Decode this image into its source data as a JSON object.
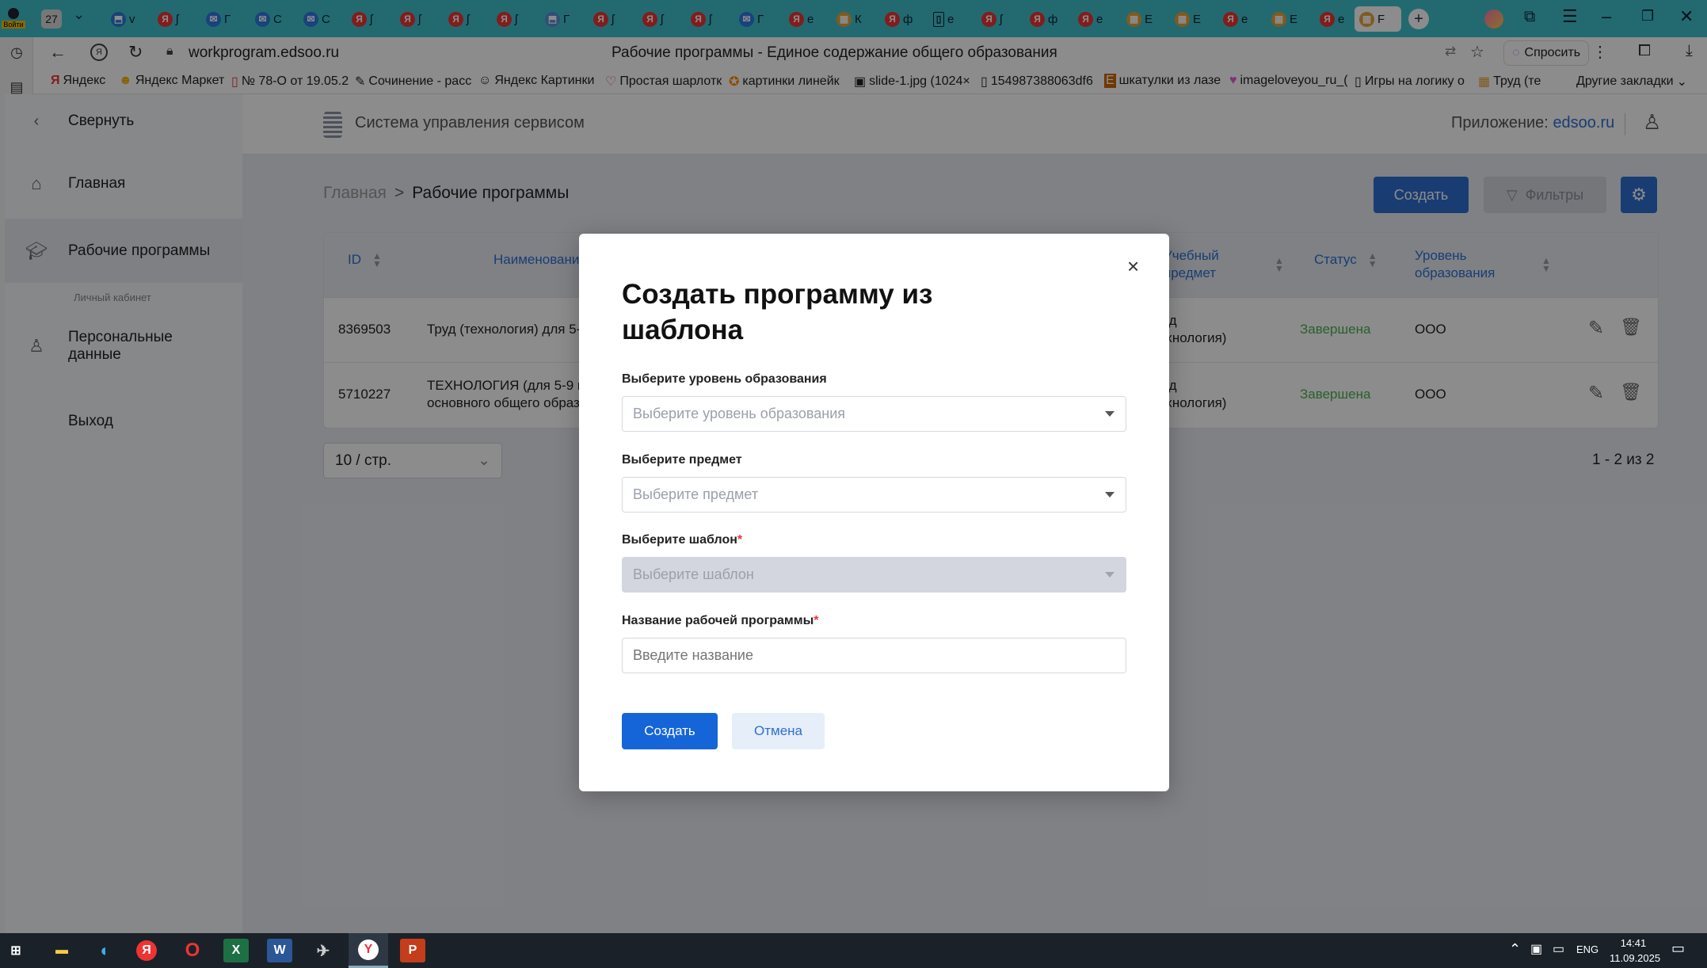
{
  "browser": {
    "tabs": [
      {
        "icon": "profile",
        "label": "Войти"
      },
      {
        "icon": "counter",
        "label": "27"
      },
      {
        "icon": "chevron",
        "label": "⌄"
      },
      {
        "icon": "site",
        "label": "v"
      },
      {
        "icon": "yandex",
        "label": "Я"
      },
      {
        "icon": "mail",
        "label": "Г"
      },
      {
        "icon": "mail",
        "label": "С"
      },
      {
        "icon": "mail",
        "label": "С"
      },
      {
        "icon": "yandex",
        "label": "Я"
      },
      {
        "icon": "yandex",
        "label": "Я"
      },
      {
        "icon": "yandex",
        "label": "Я"
      },
      {
        "icon": "yandex",
        "label": "Я"
      },
      {
        "icon": "site",
        "label": "Г"
      },
      {
        "icon": "yandex",
        "label": "Я"
      },
      {
        "icon": "yandex",
        "label": "Я"
      },
      {
        "icon": "yandex",
        "label": "Я"
      },
      {
        "icon": "mail",
        "label": "Г"
      },
      {
        "icon": "yandex",
        "label": "е"
      },
      {
        "icon": "site",
        "label": "К"
      },
      {
        "icon": "yandex",
        "label": "ф"
      },
      {
        "icon": "doc",
        "label": "е"
      },
      {
        "icon": "yandex",
        "label": "Я"
      },
      {
        "icon": "yandex",
        "label": "ф"
      },
      {
        "icon": "yandex",
        "label": "е"
      },
      {
        "icon": "site",
        "label": "Е"
      },
      {
        "icon": "site",
        "label": "Е"
      },
      {
        "icon": "yandex",
        "label": "е"
      },
      {
        "icon": "site",
        "label": "Е"
      },
      {
        "icon": "yandex",
        "label": "е"
      },
      {
        "icon": "site",
        "label": "F"
      }
    ],
    "new_tab": "+",
    "url": "workprogram.edsoo.ru",
    "page_title": "Рабочие программы - Единое содержание общего образования",
    "ask_button": "Спросить",
    "bookmarks": [
      "Яндекс",
      "Яндекс Маркет",
      "№ 78-О от 19.05.2",
      "Сочинение - расс",
      "Яндекс Картинки",
      "Простая шарлотк",
      "картинки линейк",
      "slide-1.jpg (1024×",
      "154987388063df6",
      "шкатулки из лазе",
      "imageloveyou_ru_(",
      "Игры на логику о",
      "Труд (те"
    ],
    "other_bookmarks": "Другие закладки"
  },
  "sidebar": {
    "collapse": "Свернуть",
    "home": "Главная",
    "programs": "Рабочие программы",
    "section_label": "Личный кабинет",
    "personal": "Персональные данные",
    "exit": "Выход"
  },
  "header": {
    "system_title": "Система управления сервисом",
    "app_label": "Приложение:",
    "app_value": "edsoo.ru"
  },
  "page": {
    "breadcrumb_root": "Главная",
    "breadcrumb_sep": ">",
    "breadcrumb_current": "Рабочие программы",
    "create_button": "Создать",
    "filters_button": "Фильтры"
  },
  "table": {
    "columns": [
      "ID",
      "Наименовани",
      "Учебный предмет",
      "Статус",
      "Уровень образования"
    ],
    "rows": [
      {
        "id": "8369503",
        "name": "Труд (технология) для 5-",
        "subject": "Труд (технология)",
        "status": "Завершена",
        "level": "ООО"
      },
      {
        "id": "5710227",
        "name": "ТЕХНОЛОГИЯ (для 5-9 к основного общего образ",
        "subject": "Труд (технология)",
        "status": "Завершена",
        "level": "ООО"
      }
    ],
    "page_size": "10 / стр.",
    "range": "1 - 2 из 2"
  },
  "modal": {
    "title": "Создать программу из шаблона",
    "close": "×",
    "level_label": "Выберите уровень образования",
    "level_placeholder": "Выберите уровень образования",
    "subject_label": "Выберите предмет",
    "subject_placeholder": "Выберите предмет",
    "template_label": "Выберите шаблон",
    "template_placeholder": "Выберите шаблон",
    "name_label": "Название рабочей программы",
    "name_placeholder": "Введите название",
    "required_mark": "*",
    "submit": "Создать",
    "cancel": "Отмена"
  },
  "taskbar": {
    "lang": "ENG",
    "time": "14:41",
    "date": "11.09.2025",
    "apps": [
      "windows",
      "explorer",
      "edge",
      "yandex",
      "opera",
      "excel",
      "word",
      "app",
      "yandex-browser",
      "powerpoint"
    ]
  },
  "colors": {
    "primary": "#1565d8",
    "header_primary": "#2f6fd0",
    "status_green": "#4caf50",
    "tabbar": "#3fc2cc"
  }
}
